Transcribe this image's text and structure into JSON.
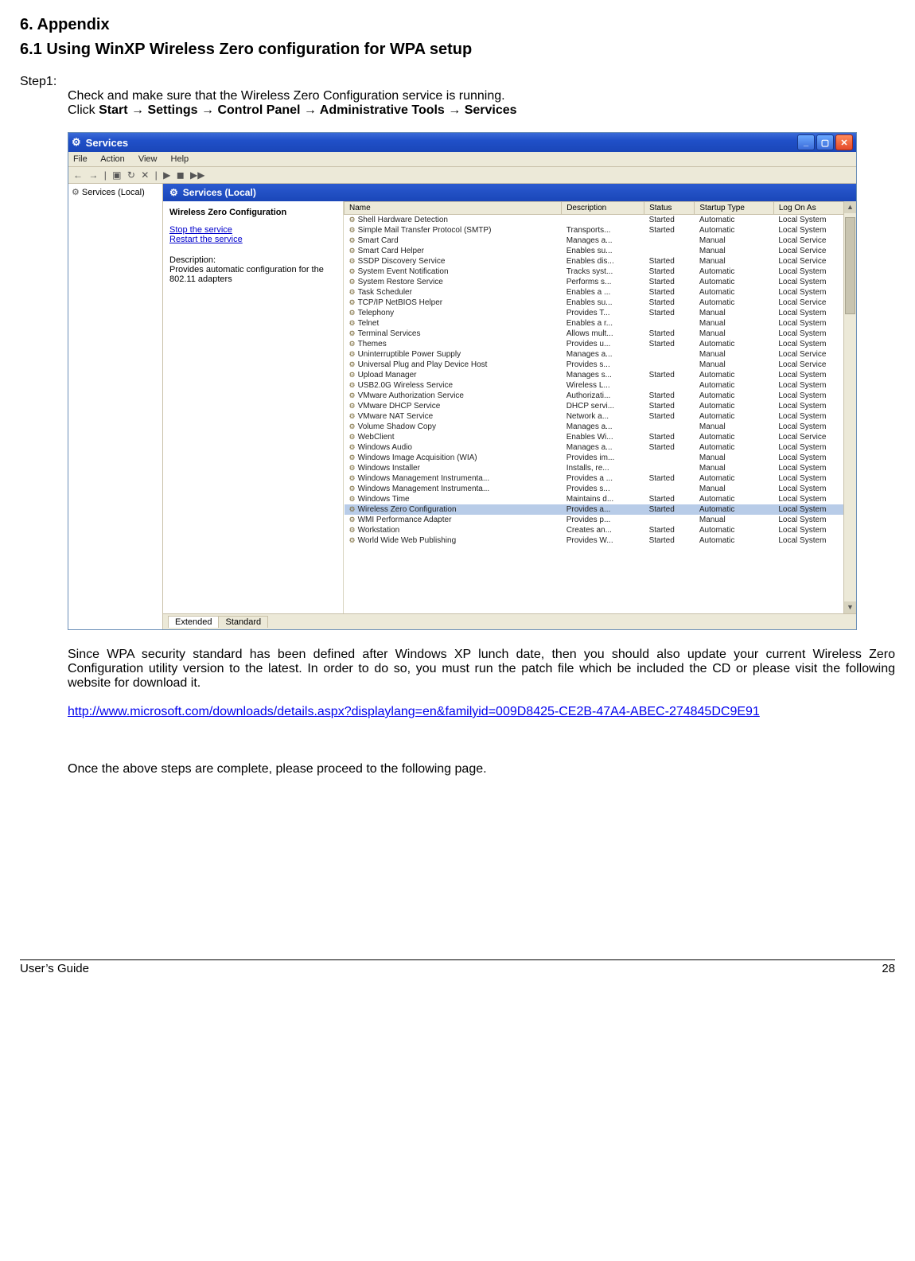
{
  "headings": {
    "appendix": "6. Appendix",
    "section": "6.1 Using WinXP Wireless Zero configuration for WPA setup"
  },
  "step1": {
    "label": "Step1:",
    "line1": "Check and make sure that the Wireless Zero Configuration service is running.",
    "line2_prefix": "Click ",
    "line2_bold": "Start → Settings → Control Panel → Administrative Tools → Services"
  },
  "paragraph": "Since WPA security standard has been defined after Windows XP lunch date, then you should also update your current Wireless Zero Configuration utility version to the latest. In order to do so, you must run the patch file which be included the CD or please visit the following website for download it.",
  "link": "http://www.microsoft.com/downloads/details.aspx?displaylang=en&familyid=009D8425-CE2B-47A4-ABEC-274845DC9E91",
  "closing": "Once the above steps are complete, please proceed to the following page.",
  "footer": {
    "left": "User’s Guide",
    "right": "28"
  },
  "win": {
    "title": "Services",
    "menu": [
      "File",
      "Action",
      "View",
      "Help"
    ],
    "toolbar_glyphs": [
      "←",
      "→",
      "▣",
      "↻",
      "✕",
      "▶",
      "◼",
      "▶▶"
    ],
    "tree_root": "Services (Local)",
    "detail_title": "Services (Local)",
    "left_panel": {
      "service": "Wireless Zero Configuration",
      "stop": "Stop the service",
      "restart": "Restart the service",
      "desc_label": "Description:",
      "desc": "Provides automatic configuration for the 802.11 adapters"
    },
    "columns": [
      "Name",
      "Description",
      "Status",
      "Startup Type",
      "Log On As"
    ],
    "rows": [
      [
        "Shell Hardware Detection",
        "",
        "Started",
        "Automatic",
        "Local System"
      ],
      [
        "Simple Mail Transfer Protocol (SMTP)",
        "Transports...",
        "Started",
        "Automatic",
        "Local System"
      ],
      [
        "Smart Card",
        "Manages a...",
        "",
        "Manual",
        "Local Service"
      ],
      [
        "Smart Card Helper",
        "Enables su...",
        "",
        "Manual",
        "Local Service"
      ],
      [
        "SSDP Discovery Service",
        "Enables dis...",
        "Started",
        "Manual",
        "Local Service"
      ],
      [
        "System Event Notification",
        "Tracks syst...",
        "Started",
        "Automatic",
        "Local System"
      ],
      [
        "System Restore Service",
        "Performs s...",
        "Started",
        "Automatic",
        "Local System"
      ],
      [
        "Task Scheduler",
        "Enables a ...",
        "Started",
        "Automatic",
        "Local System"
      ],
      [
        "TCP/IP NetBIOS Helper",
        "Enables su...",
        "Started",
        "Automatic",
        "Local Service"
      ],
      [
        "Telephony",
        "Provides T...",
        "Started",
        "Manual",
        "Local System"
      ],
      [
        "Telnet",
        "Enables a r...",
        "",
        "Manual",
        "Local System"
      ],
      [
        "Terminal Services",
        "Allows mult...",
        "Started",
        "Manual",
        "Local System"
      ],
      [
        "Themes",
        "Provides u...",
        "Started",
        "Automatic",
        "Local System"
      ],
      [
        "Uninterruptible Power Supply",
        "Manages a...",
        "",
        "Manual",
        "Local Service"
      ],
      [
        "Universal Plug and Play Device Host",
        "Provides s...",
        "",
        "Manual",
        "Local Service"
      ],
      [
        "Upload Manager",
        "Manages s...",
        "Started",
        "Automatic",
        "Local System"
      ],
      [
        "USB2.0G Wireless Service",
        "Wireless L...",
        "",
        "Automatic",
        "Local System"
      ],
      [
        "VMware Authorization Service",
        "Authorizati...",
        "Started",
        "Automatic",
        "Local System"
      ],
      [
        "VMware DHCP Service",
        "DHCP servi...",
        "Started",
        "Automatic",
        "Local System"
      ],
      [
        "VMware NAT Service",
        "Network a...",
        "Started",
        "Automatic",
        "Local System"
      ],
      [
        "Volume Shadow Copy",
        "Manages a...",
        "",
        "Manual",
        "Local System"
      ],
      [
        "WebClient",
        "Enables Wi...",
        "Started",
        "Automatic",
        "Local Service"
      ],
      [
        "Windows Audio",
        "Manages a...",
        "Started",
        "Automatic",
        "Local System"
      ],
      [
        "Windows Image Acquisition (WIA)",
        "Provides im...",
        "",
        "Manual",
        "Local System"
      ],
      [
        "Windows Installer",
        "Installs, re...",
        "",
        "Manual",
        "Local System"
      ],
      [
        "Windows Management Instrumenta...",
        "Provides a ...",
        "Started",
        "Automatic",
        "Local System"
      ],
      [
        "Windows Management Instrumenta...",
        "Provides s...",
        "",
        "Manual",
        "Local System"
      ],
      [
        "Windows Time",
        "Maintains d...",
        "Started",
        "Automatic",
        "Local System"
      ],
      [
        "Wireless Zero Configuration",
        "Provides a...",
        "Started",
        "Automatic",
        "Local System"
      ],
      [
        "WMI Performance Adapter",
        "Provides p...",
        "",
        "Manual",
        "Local System"
      ],
      [
        "Workstation",
        "Creates an...",
        "Started",
        "Automatic",
        "Local System"
      ],
      [
        "World Wide Web Publishing",
        "Provides W...",
        "Started",
        "Automatic",
        "Local System"
      ]
    ],
    "selected_row": 28,
    "tabs": [
      "Extended",
      "Standard"
    ]
  }
}
